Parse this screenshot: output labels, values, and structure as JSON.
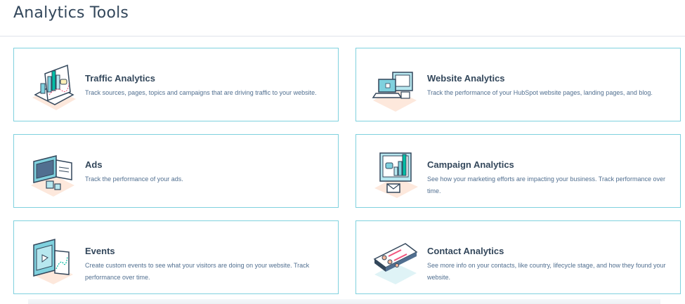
{
  "page": {
    "title": "Analytics Tools"
  },
  "colors": {
    "card_border": "#7fd1de",
    "title_text": "#33475b",
    "desc_text": "#516f90",
    "accent_teal": "#00bda5",
    "accent_blue": "#7fd1de",
    "accent_peach": "#fde8dc"
  },
  "cards": [
    {
      "title": "Traffic Analytics",
      "description": "Track sources, pages, topics and campaigns that are driving traffic to your website.",
      "icon": "traffic-chart-icon"
    },
    {
      "title": "Website Analytics",
      "description": "Track the performance of your HubSpot website pages, landing pages, and blog.",
      "icon": "devices-icon"
    },
    {
      "title": "Ads",
      "description": "Track the performance of your ads.",
      "icon": "ads-monitor-icon"
    },
    {
      "title": "Campaign Analytics",
      "description": "See how your marketing efforts are impacting your business. Track performance over time.",
      "icon": "campaign-chart-icon"
    },
    {
      "title": "Events",
      "description": "Create custom events to see what your visitors are doing on your website. Track performance over time.",
      "icon": "events-video-icon"
    },
    {
      "title": "Contact Analytics",
      "description": "See more info on your contacts, like country, lifecycle stage, and how they found your website.",
      "icon": "contact-card-icon"
    }
  ]
}
